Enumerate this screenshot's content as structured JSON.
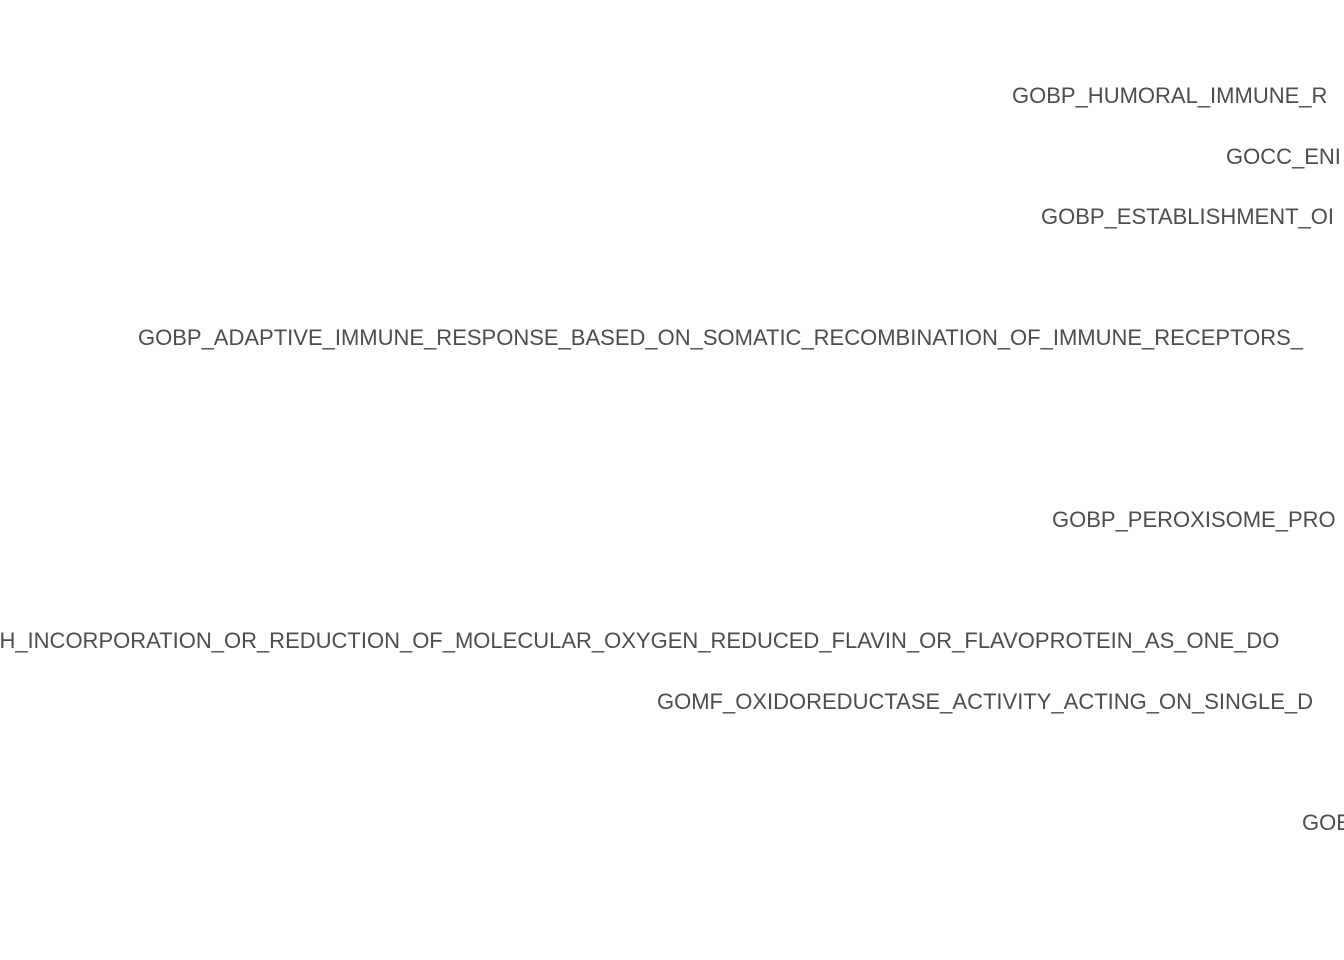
{
  "chart_data": {
    "type": "bar",
    "categories": [
      "GOBP_HUMORAL_IMMUNE_R",
      "GOCC_ENI",
      "GOBP_ESTABLISHMENT_OI",
      "",
      "GOBP_ADAPTIVE_IMMUNE_RESPONSE_BASED_ON_SOMATIC_RECOMBINATION_OF_IMMUNE_RECEPTORS_",
      "",
      "",
      "GOBP_PEROXISOME_PRO",
      "",
      "TH_INCORPORATION_OR_REDUCTION_OF_MOLECULAR_OXYGEN_REDUCED_FLAVIN_OR_FLAVOPROTEIN_AS_ONE_DO",
      "GOMF_OXIDOREDUCTASE_ACTIVITY_ACTING_ON_SINGLE_D",
      "",
      "GOE"
    ],
    "title": "",
    "xlabel": "",
    "ylabel": "",
    "grid": false,
    "text_color": "#4d4d4d",
    "background": "#ffffff"
  }
}
